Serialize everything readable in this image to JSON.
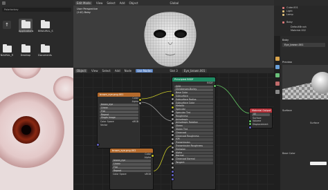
{
  "file_browser": {
    "path": "Polartonkey",
    "folders": [
      {
        "label": "Applications"
      },
      {
        "label": "BINAURAL_S"
      },
      {
        "label": "NAURAL_Fi"
      },
      {
        "label": "Desktop"
      },
      {
        "label": "Documents"
      }
    ]
  },
  "viewport": {
    "menus": [
      "View",
      "Select",
      "Add",
      "Object"
    ],
    "mode": "Edit Mode",
    "shading_label": "Global",
    "info_line1": "User Perspective",
    "info_line2": "(142) Baby"
  },
  "outliner": {
    "items": [
      "Cube.001",
      "Light",
      "Lamp",
      "Baby",
      "DefaultBrush",
      "Material.002"
    ]
  },
  "node_editor": {
    "menus": [
      "Object",
      "View",
      "Select",
      "Add",
      "Node"
    ],
    "use_nodes": "Use Nodes",
    "slot": "Slot 3",
    "material": "Eye_brown.001",
    "node_principled_title": "Principled BSDF",
    "node_output_title": "Material Output",
    "node_image1_title": "brown_eye.png.001",
    "node_image2_title": "brown_eye.png.002",
    "principled_rows": [
      "BSDF",
      "GGX",
      "Christensen-Burley",
      "Base Color",
      "Subsurface",
      "Subsurface Radius",
      "Subsurface Color",
      "Metallic",
      "Specular",
      "Specular Tint",
      "Roughness",
      "Anisotropic",
      "Anisotropic Rotation",
      "Sheen",
      "Sheen Tint",
      "Clearcoat",
      "Clearcoat Roughness",
      "IOR",
      "Transmission",
      "Transmission Roughness",
      "Emission",
      "Alpha",
      "Normal",
      "Clearcoat Normal",
      "Tangent"
    ],
    "output_rows": [
      "All",
      "Surface",
      "Volume",
      "Displacement"
    ],
    "image_rows": [
      "Color",
      "Alpha",
      "Linear",
      "Flat",
      "Repeat",
      "Single Image",
      "Color Space",
      "sRGB",
      "Vector"
    ],
    "image_file": "brown_eye",
    "color_space": "sRGB"
  },
  "properties": {
    "object": "Baby",
    "material_name": "Eye_brown.001",
    "preview_label": "Preview",
    "surface_label": "Surface",
    "surface_value": "Surface",
    "base_color_label": "Base Color"
  },
  "colors": {
    "node_header_texture": "#b46a2c",
    "node_header_shader": "#1e8a62",
    "node_header_output": "#b5323a",
    "socket_yellow": "#c7c729",
    "socket_green": "#63c763",
    "socket_purple": "#6363c7",
    "socket_grey": "#a1a1a1"
  }
}
